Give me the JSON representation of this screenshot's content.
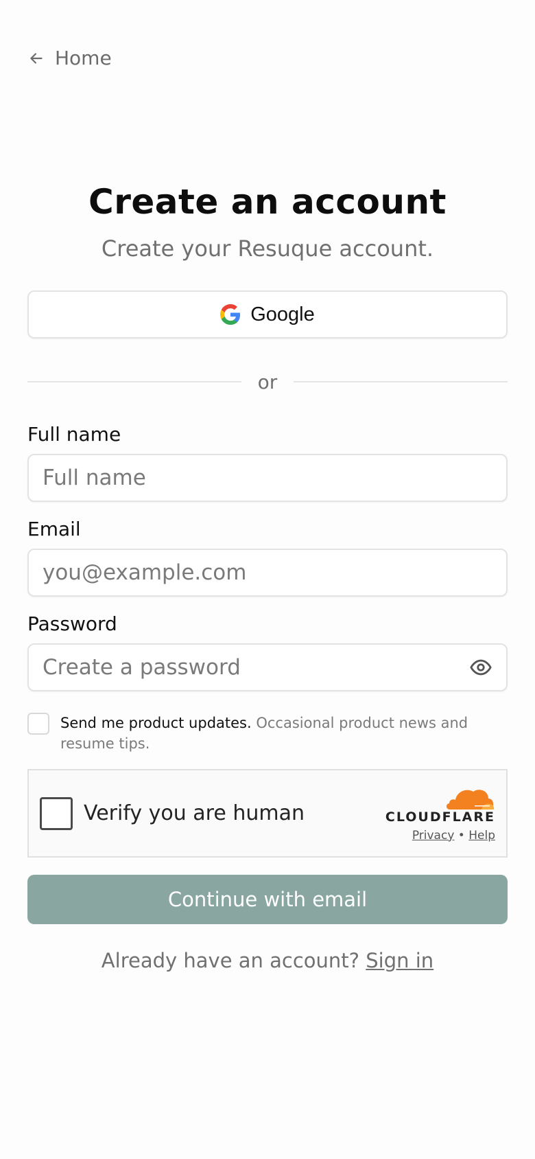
{
  "nav": {
    "back_label": "Home"
  },
  "header": {
    "title": "Create an account",
    "subtitle": "Create your Resuque account."
  },
  "oauth": {
    "google_label": "Google"
  },
  "divider": {
    "text": "or"
  },
  "form": {
    "full_name": {
      "label": "Full name",
      "placeholder": "Full name"
    },
    "email": {
      "label": "Email",
      "placeholder": "you@example.com"
    },
    "password": {
      "label": "Password",
      "placeholder": "Create a password"
    },
    "updates": {
      "bold": "Send me product updates.",
      "detail": "Occasional product news and resume tips."
    },
    "submit_label": "Continue with email"
  },
  "captcha": {
    "label": "Verify you are human",
    "brand": "CLOUDFLARE",
    "privacy": "Privacy",
    "separator": "•",
    "help": "Help"
  },
  "footer": {
    "prompt": "Already have an account?",
    "signin_label": "Sign in"
  },
  "colors": {
    "primary_button": "#89a6a1",
    "cloudflare_orange": "#f48120"
  }
}
